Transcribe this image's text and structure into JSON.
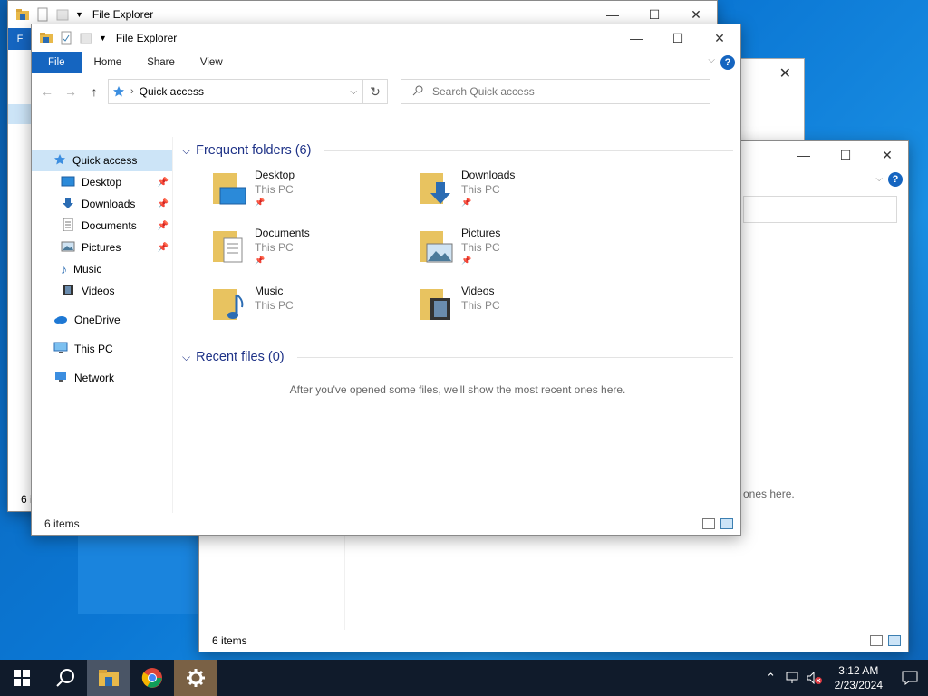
{
  "back_window_1": {
    "title": "File Explorer",
    "file_tab_partial": "F",
    "status_partial": "6 i"
  },
  "back_window_2": {
    "status": "6 items",
    "empty_partial": "ones here."
  },
  "window": {
    "title": "File Explorer",
    "tabs": {
      "file": "File",
      "home": "Home",
      "share": "Share",
      "view": "View"
    },
    "address": {
      "crumb": "Quick access"
    },
    "search": {
      "placeholder": "Search Quick access"
    },
    "nav": {
      "quick_access": "Quick access",
      "desktop": "Desktop",
      "downloads": "Downloads",
      "documents": "Documents",
      "pictures": "Pictures",
      "music": "Music",
      "videos": "Videos",
      "onedrive": "OneDrive",
      "this_pc": "This PC",
      "network": "Network"
    },
    "frequent": {
      "heading": "Frequent folders (6)",
      "items": [
        {
          "name": "Desktop",
          "location": "This PC"
        },
        {
          "name": "Downloads",
          "location": "This PC"
        },
        {
          "name": "Documents",
          "location": "This PC"
        },
        {
          "name": "Pictures",
          "location": "This PC"
        },
        {
          "name": "Music",
          "location": "This PC"
        },
        {
          "name": "Videos",
          "location": "This PC"
        }
      ]
    },
    "recent": {
      "heading": "Recent files (0)",
      "empty_message": "After you've opened some files, we'll show the most recent ones here."
    },
    "status": "6 items"
  },
  "taskbar": {
    "clock_time": "3:12 AM",
    "clock_date": "2/23/2024"
  },
  "colors": {
    "accent": "#1565c0",
    "taskbar": "#101b2b",
    "selection": "#cce4f7",
    "group_heading": "#1e3287"
  }
}
